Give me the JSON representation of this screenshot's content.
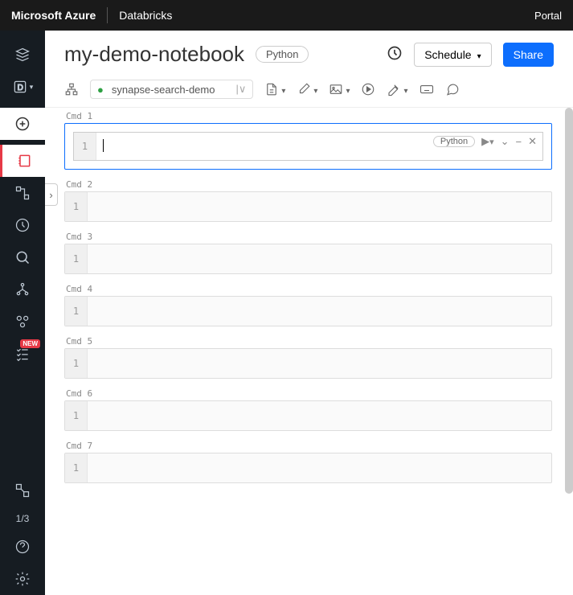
{
  "topbar": {
    "brand": "Microsoft Azure",
    "product": "Databricks",
    "portal": "Portal"
  },
  "header": {
    "title": "my-demo-notebook",
    "language": "Python",
    "schedule_label": "Schedule",
    "share_label": "Share"
  },
  "toolbar": {
    "cluster_name": "synapse-search-demo"
  },
  "sidebar": {
    "badge_new": "NEW",
    "pager": "1/3"
  },
  "cells": [
    {
      "label": "Cmd 1",
      "line": "1",
      "active": true,
      "lang_pill": "Python"
    },
    {
      "label": "Cmd 2",
      "line": "1",
      "active": false
    },
    {
      "label": "Cmd 3",
      "line": "1",
      "active": false
    },
    {
      "label": "Cmd 4",
      "line": "1",
      "active": false
    },
    {
      "label": "Cmd 5",
      "line": "1",
      "active": false
    },
    {
      "label": "Cmd 6",
      "line": "1",
      "active": false
    },
    {
      "label": "Cmd 7",
      "line": "1",
      "active": false
    }
  ]
}
